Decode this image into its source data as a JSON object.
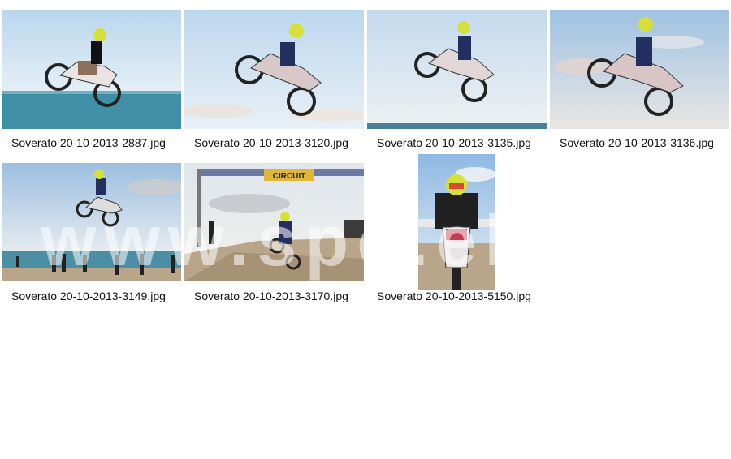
{
  "gallery": {
    "items": [
      {
        "filename": "Soverato 20-10-2013-2887.jpg"
      },
      {
        "filename": "Soverato 20-10-2013-3120.jpg"
      },
      {
        "filename": "Soverato 20-10-2013-3135.jpg"
      },
      {
        "filename": "Soverato 20-10-2013-3136.jpg"
      },
      {
        "filename": "Soverato 20-10-2013-3149.jpg"
      },
      {
        "filename": "Soverato 20-10-2013-3170.jpg"
      },
      {
        "filename": "Soverato 20-10-2013-5150.jpg"
      }
    ],
    "banner_text": "CIRCUIT",
    "watermark_text": "www.spo.el"
  },
  "colors": {
    "sky": "#c9dff2",
    "sea": "#3f8fa6",
    "sand": "#b9a58a",
    "banner": "#e2b637",
    "rider_blue": "#22305f",
    "helmet": "#d7e03a"
  }
}
